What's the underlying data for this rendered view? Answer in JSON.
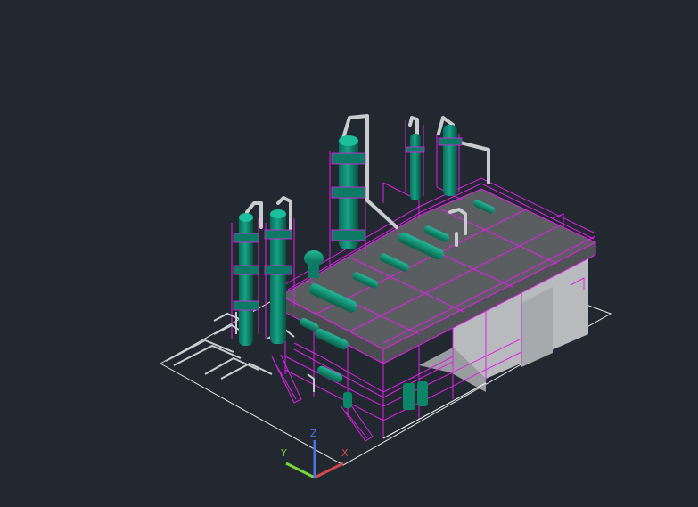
{
  "viewport": {
    "background": "#212830",
    "view_style": "3D isometric, shaded with edges"
  },
  "model": {
    "description_colors": {
      "equipment": "#0f8a72",
      "equipment_shadow": "#075d4d",
      "structure_lines": "#e020e8",
      "pipes": "#c9cccf",
      "deck": "#5c5f62",
      "wall": "#b9bcbe",
      "outline": "#ffffff"
    }
  },
  "ucs_icon": {
    "axes": [
      {
        "name": "X",
        "color": "#d94848"
      },
      {
        "name": "Y",
        "color": "#7bd43c"
      },
      {
        "name": "Z",
        "color": "#4a73e8"
      }
    ]
  }
}
